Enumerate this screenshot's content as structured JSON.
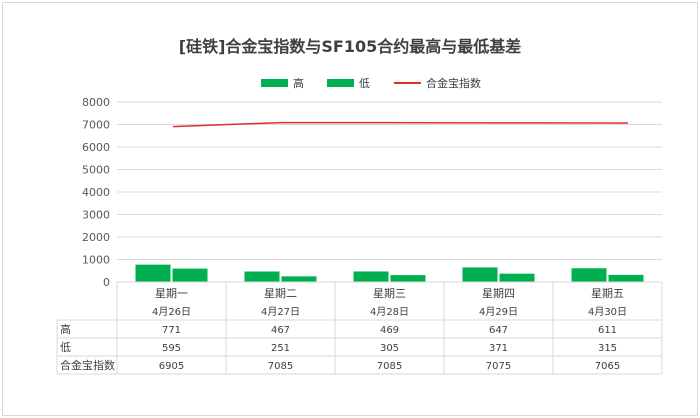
{
  "chart_data": {
    "type": "bar",
    "title": "[硅铁]合金宝指数与SF105合约最高与最低基差",
    "categories": [
      "星期一",
      "星期二",
      "星期三",
      "星期四",
      "星期五"
    ],
    "dates": [
      "4月26日",
      "4月27日",
      "4月28日",
      "4月29日",
      "4月30日"
    ],
    "series": [
      {
        "name": "高",
        "type": "bar",
        "color": "#00b050",
        "values": [
          771,
          467,
          469,
          647,
          611
        ]
      },
      {
        "name": "低",
        "type": "bar",
        "color": "#00b050",
        "values": [
          595,
          251,
          305,
          371,
          315
        ]
      },
      {
        "name": "合金宝指数",
        "type": "line",
        "color": "#e03030",
        "values": [
          6905,
          7085,
          7085,
          7075,
          7065
        ]
      }
    ],
    "ylim": [
      0,
      8000
    ],
    "yticks": [
      0,
      1000,
      2000,
      3000,
      4000,
      5000,
      6000,
      7000,
      8000
    ],
    "grid": true,
    "legend": "top",
    "data_table": true
  }
}
